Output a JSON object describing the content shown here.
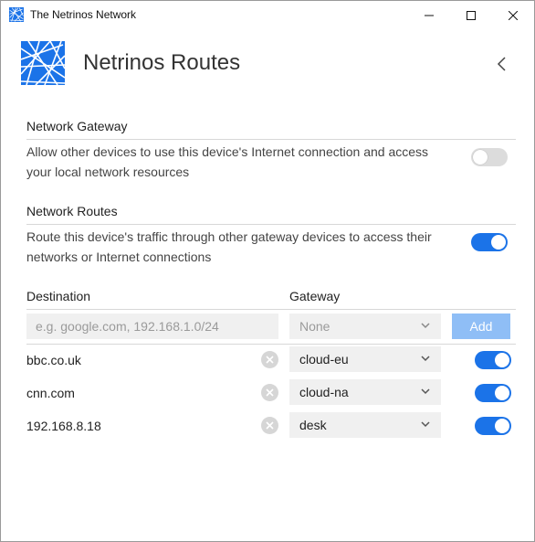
{
  "window": {
    "title": "The Netrinos Network"
  },
  "header": {
    "title": "Netrinos Routes"
  },
  "gateway": {
    "title": "Network Gateway",
    "description": "Allow other devices to use this device's Internet connection and access your local network resources",
    "enabled": false
  },
  "routes": {
    "title": "Network Routes",
    "description": "Route this device's traffic through other gateway devices to access their networks or Internet connections",
    "enabled": true
  },
  "table": {
    "destination_header": "Destination",
    "gateway_header": "Gateway",
    "new_route": {
      "destination_placeholder": "e.g. google.com, 192.168.1.0/24",
      "gateway_placeholder": "None",
      "add_label": "Add"
    },
    "rows": [
      {
        "destination": "bbc.co.uk",
        "gateway": "cloud-eu",
        "enabled": true
      },
      {
        "destination": "cnn.com",
        "gateway": "cloud-na",
        "enabled": true
      },
      {
        "destination": "192.168.8.18",
        "gateway": "desk",
        "enabled": true
      }
    ]
  },
  "colors": {
    "accent": "#1b73e8",
    "add_button": "#8fbef6",
    "field_bg": "#f0f0f0",
    "logo": "#1b73e8"
  },
  "icons": {
    "app": "netrinos-logo-icon",
    "back": "chevron-left-icon",
    "remove": "close-circle-icon",
    "dropdown": "chevron-down-icon"
  }
}
